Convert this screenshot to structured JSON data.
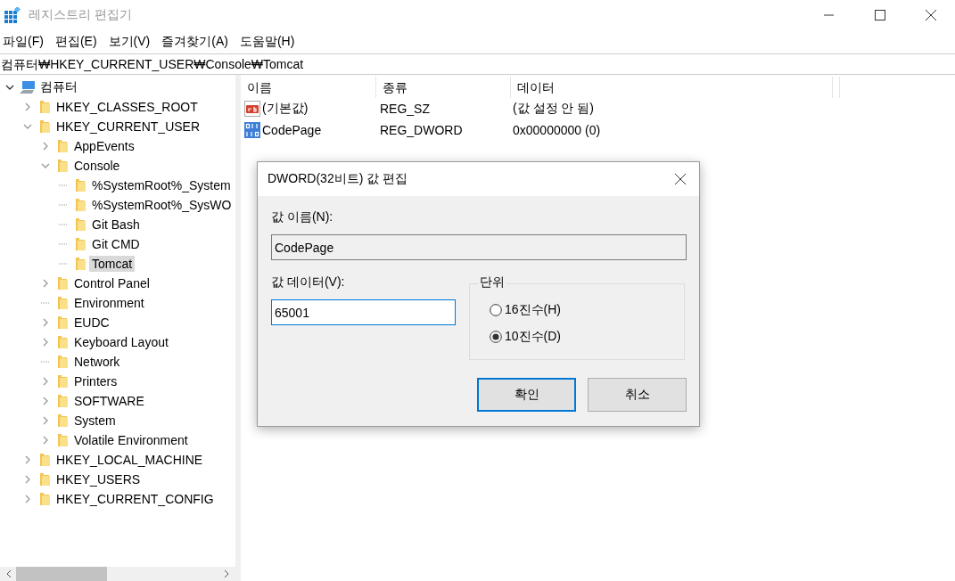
{
  "window": {
    "title": "레지스트리 편집기"
  },
  "menu": [
    "파일(F)",
    "편집(E)",
    "보기(V)",
    "즐겨찾기(A)",
    "도움말(H)"
  ],
  "address": "컴퓨터₩HKEY_CURRENT_USER₩Console₩Tomcat",
  "tree": [
    {
      "label": "컴퓨터",
      "kind": "computer",
      "expanded": true,
      "selected": false,
      "children": [
        {
          "label": "HKEY_CLASSES_ROOT",
          "kind": "branch",
          "expanded": false,
          "selected": false
        },
        {
          "label": "HKEY_CURRENT_USER",
          "kind": "branch",
          "expanded": true,
          "selected": false,
          "children": [
            {
              "label": "AppEvents",
              "kind": "branch",
              "expanded": false,
              "selected": false
            },
            {
              "label": "Console",
              "kind": "branch",
              "expanded": true,
              "selected": false,
              "children": [
                {
                  "label": "%SystemRoot%_System",
                  "kind": "leaf",
                  "selected": false
                },
                {
                  "label": "%SystemRoot%_SysWO",
                  "kind": "leaf",
                  "selected": false
                },
                {
                  "label": "Git Bash",
                  "kind": "leaf",
                  "selected": false
                },
                {
                  "label": "Git CMD",
                  "kind": "leaf",
                  "selected": false
                },
                {
                  "label": "Tomcat",
                  "kind": "leaf",
                  "selected": true
                }
              ]
            },
            {
              "label": "Control Panel",
              "kind": "branch",
              "expanded": false,
              "selected": false
            },
            {
              "label": "Environment",
              "kind": "leaf",
              "selected": false
            },
            {
              "label": "EUDC",
              "kind": "branch",
              "expanded": false,
              "selected": false
            },
            {
              "label": "Keyboard Layout",
              "kind": "branch",
              "expanded": false,
              "selected": false
            },
            {
              "label": "Network",
              "kind": "leaf",
              "selected": false
            },
            {
              "label": "Printers",
              "kind": "branch",
              "expanded": false,
              "selected": false
            },
            {
              "label": "SOFTWARE",
              "kind": "branch",
              "expanded": false,
              "selected": false
            },
            {
              "label": "System",
              "kind": "branch",
              "expanded": false,
              "selected": false
            },
            {
              "label": "Volatile Environment",
              "kind": "branch",
              "expanded": false,
              "selected": false
            }
          ]
        },
        {
          "label": "HKEY_LOCAL_MACHINE",
          "kind": "branch",
          "expanded": false,
          "selected": false
        },
        {
          "label": "HKEY_USERS",
          "kind": "branch",
          "expanded": false,
          "selected": false
        },
        {
          "label": "HKEY_CURRENT_CONFIG",
          "kind": "branch",
          "expanded": false,
          "selected": false
        }
      ]
    }
  ],
  "values": {
    "columns": [
      "이름",
      "종류",
      "데이터"
    ],
    "rows": [
      {
        "kind": "string",
        "name": "(기본값)",
        "type": "REG_SZ",
        "data": "(값 설정 안 됨)"
      },
      {
        "kind": "binary",
        "name": "CodePage",
        "type": "REG_DWORD",
        "data": "0x00000000 (0)"
      }
    ]
  },
  "dialog": {
    "title": "DWORD(32비트) 값 편집",
    "name_label": "값 이름(N):",
    "name_value": "CodePage",
    "data_label": "값 데이터(V):",
    "data_value": "65001",
    "base_label": "단위",
    "bases": [
      {
        "label": "16진수(H)",
        "selected": false
      },
      {
        "label": "10진수(D)",
        "selected": true
      }
    ],
    "buttons": [
      {
        "label": "확인",
        "default": true
      },
      {
        "label": "취소",
        "default": false
      }
    ]
  }
}
